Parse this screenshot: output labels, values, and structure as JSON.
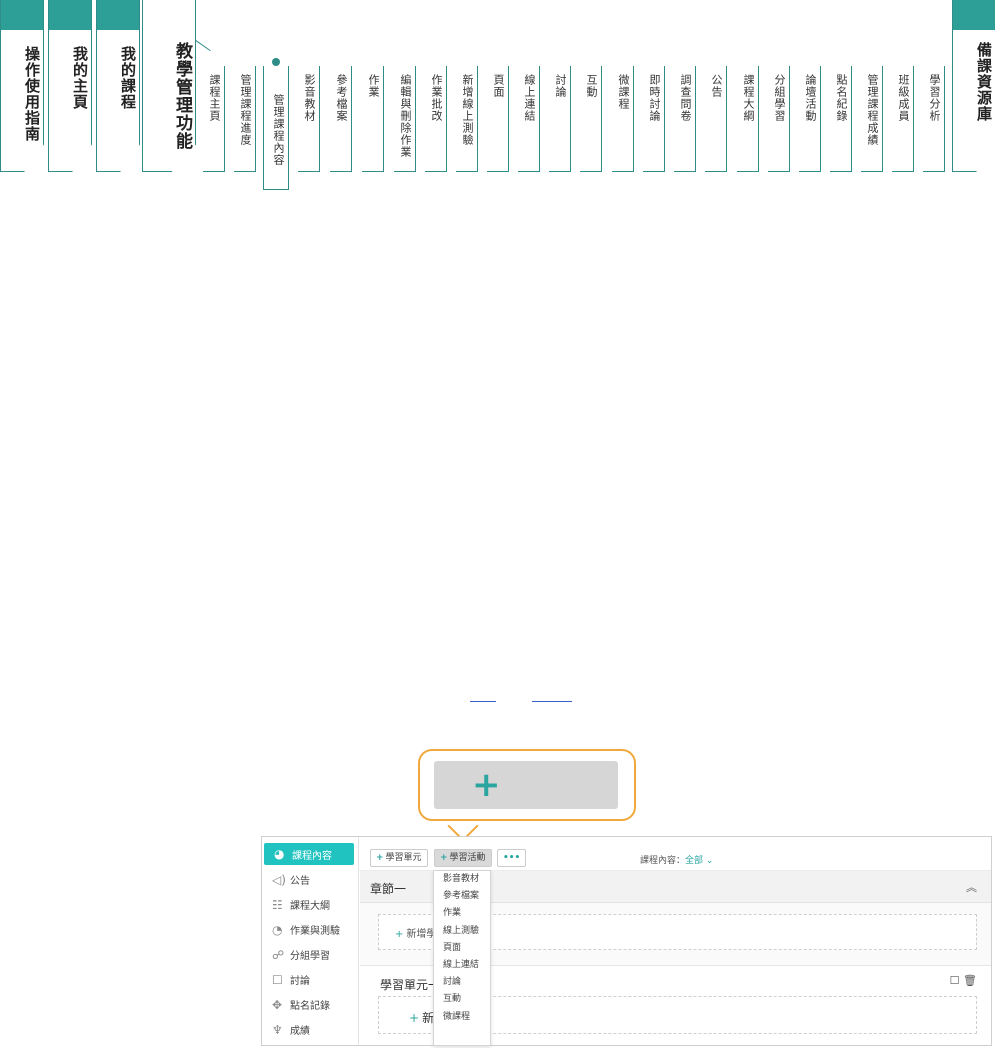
{
  "nav": {
    "guide": "操作使用指南",
    "my_home": "我的主頁",
    "my_courses": "我的課程",
    "teaching": "教學管理功能",
    "library": "備課資源庫",
    "sub_items": [
      "課程主頁",
      "管理課程進度",
      "管理課程內容",
      "影音教材",
      "參考檔案",
      "作業",
      "編輯與刪除作業",
      "作業批改",
      "新增線上測驗",
      "頁面",
      "線上連結",
      "討論",
      "互動",
      "微課程",
      "即時討論",
      "調查問卷",
      "公告",
      "課程大綱",
      "分組學習",
      "論壇活動",
      "點名紀錄",
      "管理課程成績",
      "班級成員",
      "學習分析"
    ],
    "active_index": 2,
    "accent_color": "#2e8d87"
  },
  "callout": {
    "icon": "plus-icon",
    "border_color": "#f0a93c"
  },
  "app": {
    "sidebar": [
      {
        "icon": "course-content-icon",
        "label": "課程內容",
        "active": true
      },
      {
        "icon": "megaphone-icon",
        "label": "公告"
      },
      {
        "icon": "outline-icon",
        "label": "課程大綱"
      },
      {
        "icon": "gauge-icon",
        "label": "作業與測驗"
      },
      {
        "icon": "group-icon",
        "label": "分組學習"
      },
      {
        "icon": "chat-icon",
        "label": "討論"
      },
      {
        "icon": "rollcall-icon",
        "label": "點名記錄"
      },
      {
        "icon": "trophy-icon",
        "label": "成績"
      }
    ],
    "toolbar": {
      "add_unit": "學習單元",
      "add_activity": "學習活動",
      "more": "•••",
      "filter_label": "課程內容：",
      "filter_value": "全部"
    },
    "chapter_title": "章節一",
    "add_learning_unit": "新增學",
    "unit_title": "學習單元一",
    "add_activity_short": "新",
    "dropdown": [
      "影音教材",
      "參考檔案",
      "作業",
      "線上測驗",
      "頁面",
      "線上連結",
      "討論",
      "互動",
      "微課程"
    ],
    "accent_color": "#20c3c0"
  }
}
